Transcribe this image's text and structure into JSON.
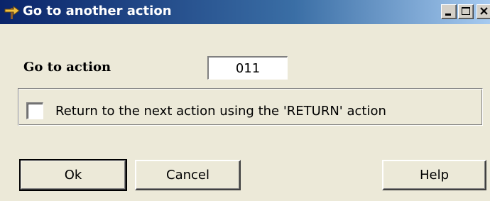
{
  "window": {
    "title": "Go to another action",
    "title_icon": "signpost-arrow-icon",
    "titlebar_colors": [
      "#0a246a",
      "#3a6ea5",
      "#a6caf0"
    ]
  },
  "form": {
    "field_label": "Go to action",
    "action_value": "011",
    "checkbox_label": "Return to the next action using the 'RETURN' action",
    "checkbox_checked": false
  },
  "buttons": {
    "ok": "Ok",
    "cancel": "Cancel",
    "help": "Help"
  }
}
